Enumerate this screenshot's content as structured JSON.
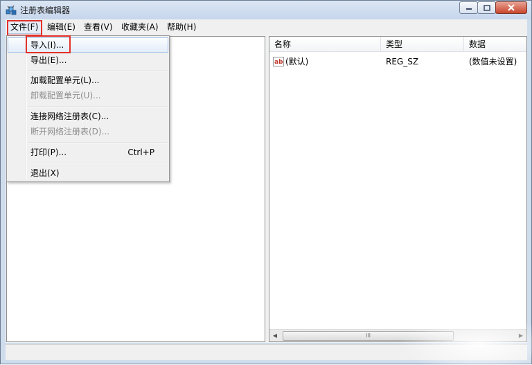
{
  "window": {
    "title": "注册表编辑器"
  },
  "menubar": {
    "items": [
      {
        "label": "文件(F)"
      },
      {
        "label": "编辑(E)"
      },
      {
        "label": "查看(V)"
      },
      {
        "label": "收藏夹(A)"
      },
      {
        "label": "帮助(H)"
      }
    ]
  },
  "file_menu": {
    "items": [
      {
        "label": "导入(I)..."
      },
      {
        "label": "导出(E)..."
      },
      {
        "label": "加载配置单元(L)..."
      },
      {
        "label": "卸载配置单元(U)..."
      },
      {
        "label": "连接网络注册表(C)..."
      },
      {
        "label": "断开网络注册表(D)..."
      },
      {
        "label": "打印(P)...",
        "shortcut": "Ctrl+P"
      },
      {
        "label": "退出(X)"
      }
    ]
  },
  "list": {
    "columns": [
      "名称",
      "类型",
      "数据"
    ],
    "rows": [
      {
        "name": "(默认)",
        "type": "REG_SZ",
        "data": "(数值未设置)"
      }
    ]
  },
  "icons": {
    "app": "regedit-icon",
    "value": "string-value-icon",
    "minimize": "minimize-icon",
    "maximize": "maximize-icon",
    "close": "close-icon"
  },
  "colors": {
    "highlight_box": "#e2302a",
    "title_bar": "#c6d6eb",
    "close_button": "#c9462c"
  },
  "scrollbar": {
    "thumb_grip": "III"
  }
}
